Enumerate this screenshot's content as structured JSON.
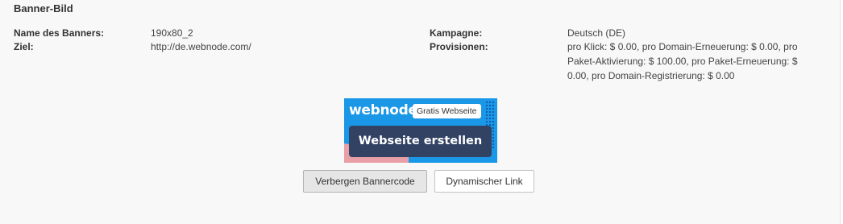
{
  "section": {
    "title": "Banner-Bild"
  },
  "details": {
    "name_label": "Name des Banners:",
    "name_value": "190x80_2",
    "target_label": "Ziel:",
    "target_value": "http://de.webnode.com/",
    "campaign_label": "Kampagne:",
    "campaign_value": "Deutsch (DE)",
    "commissions_label": "Provisionen:",
    "commissions_value": "pro Klick: $ 0.00, pro Domain-Erneuerung: $ 0.00, pro Paket-Aktivierung: $ 100.00, pro Paket-Erneuerung: $ 0.00, pro Domain-Registrierung: $ 0.00"
  },
  "banner": {
    "logo_text": "webnode",
    "tag_text": "Gratis Webseite",
    "cta_text": "Webseite erstellen",
    "colors": {
      "background": "#1a97e6",
      "cta": "#314263",
      "accent": "#e8a0a6"
    }
  },
  "actions": {
    "hide_code_label": "Verbergen Bannercode",
    "dynamic_link_label": "Dynamischer Link"
  }
}
